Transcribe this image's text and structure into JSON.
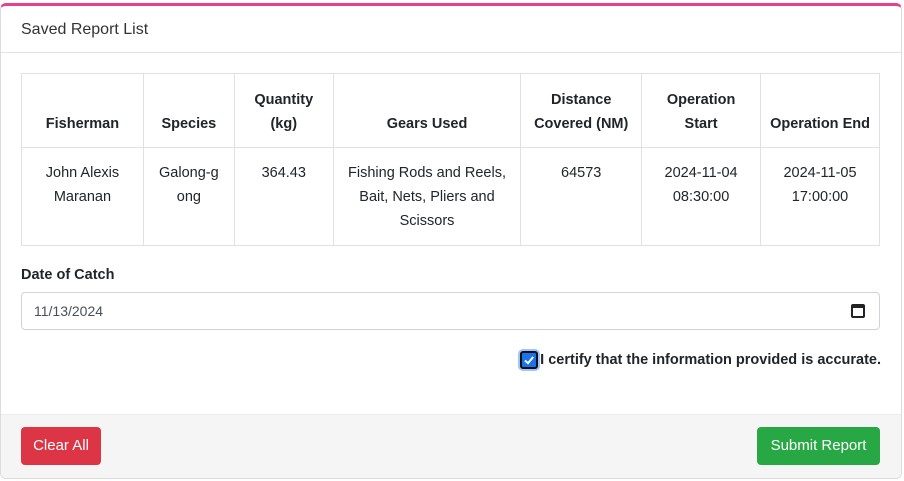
{
  "card": {
    "title": "Saved Report List"
  },
  "table": {
    "headers": [
      "Fisherman",
      "Species",
      "Quantity (kg)",
      "Gears Used",
      "Distance Covered (NM)",
      "Operation Start",
      "Operation End"
    ],
    "rows": [
      [
        "John Alexis Maranan",
        "Galong-gong",
        "364.43",
        "Fishing Rods and Reels, Bait, Nets, Pliers and Scissors",
        "64573",
        "2024-11-04 08:30:00",
        "2024-11-05 17:00:00"
      ]
    ]
  },
  "date_of_catch": {
    "label": "Date of Catch",
    "value": "11/13/2024"
  },
  "certify": {
    "label": "I certify that the information provided is accurate.",
    "checked": true
  },
  "footer": {
    "clear_label": "Clear All",
    "submit_label": "Submit Report"
  },
  "colors": {
    "accent_top": "#e83e8c",
    "danger": "#dc3545",
    "success": "#28a745",
    "checkbox": "#1a73e8"
  }
}
